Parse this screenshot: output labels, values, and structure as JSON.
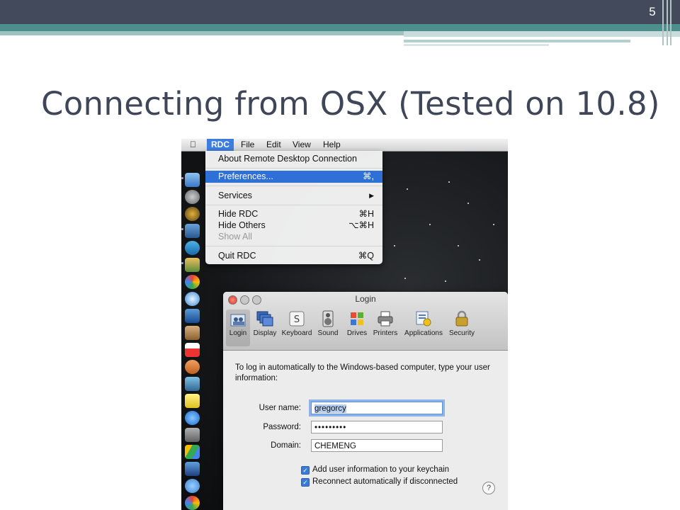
{
  "slide": {
    "page_number": "5",
    "title": "Connecting from OSX (Tested on 10.8)"
  },
  "menubar": {
    "apple": "",
    "items": [
      "RDC",
      "File",
      "Edit",
      "View",
      "Help"
    ]
  },
  "menu": {
    "about": "About Remote Desktop Connection",
    "preferences": {
      "label": "Preferences...",
      "shortcut": "⌘,"
    },
    "services": {
      "label": "Services",
      "shortcut": "▶"
    },
    "hide_rdc": {
      "label": "Hide RDC",
      "shortcut": "⌘H"
    },
    "hide_others": {
      "label": "Hide Others",
      "shortcut": "⌥⌘H"
    },
    "show_all": "Show All",
    "quit": {
      "label": "Quit RDC",
      "shortcut": "⌘Q"
    }
  },
  "window": {
    "title": "Login",
    "toolbar": [
      "Login",
      "Display",
      "Keyboard",
      "Sound",
      "Drives",
      "Printers",
      "Applications",
      "Security"
    ],
    "intro": "To log in automatically to the Windows-based computer, type your user information:",
    "username_label": "User name:",
    "username_value": "gregorcy",
    "password_label": "Password:",
    "password_value": "•••••••••",
    "domain_label": "Domain:",
    "domain_value": "CHEMENG",
    "keychain_label": "Add user information to your keychain",
    "reconnect_label": "Reconnect automatically if disconnected",
    "help": "?"
  },
  "colors": {
    "header_dark": "#434a5c",
    "header_teal": "#4c8f8c",
    "title_text": "#3f4658",
    "menu_highlight": "#2f6fd8"
  }
}
